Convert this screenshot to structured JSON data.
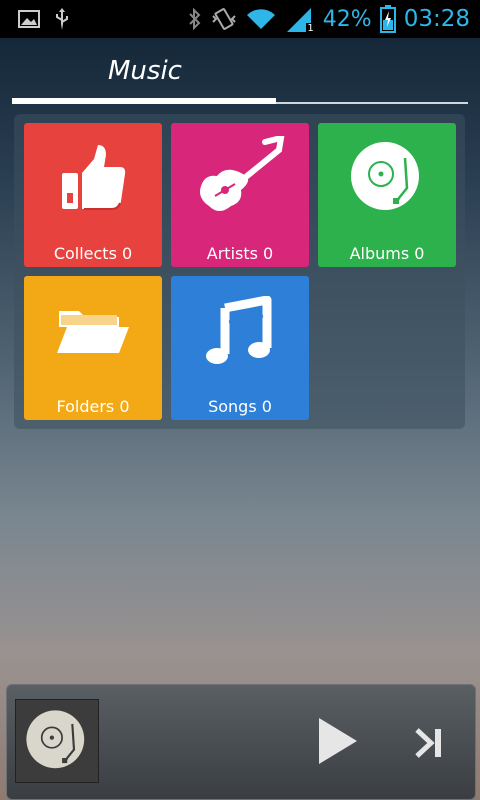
{
  "status_bar": {
    "battery": "42%",
    "time": "03:28",
    "signal_badge": "1",
    "icons": [
      "image-icon",
      "usb-icon",
      "bluetooth-icon",
      "vibrate-icon",
      "wifi-icon",
      "signal-icon",
      "battery-charging-icon"
    ],
    "accent": "#2fb6e8"
  },
  "header": {
    "title": "Music"
  },
  "tiles": [
    {
      "label": "Collects 0",
      "icon": "thumbs-up-icon",
      "color": "#e8423f"
    },
    {
      "label": "Artists 0",
      "icon": "guitar-icon",
      "color": "#d8267b"
    },
    {
      "label": "Albums 0",
      "icon": "vinyl-icon",
      "color": "#2db14d"
    },
    {
      "label": "Folders 0",
      "icon": "folder-icon",
      "color": "#f3a816"
    },
    {
      "label": "Songs 0",
      "icon": "music-note-icon",
      "color": "#2e7fd8"
    }
  ],
  "player": {
    "art_icon": "vinyl-icon",
    "controls": [
      "play-icon",
      "next-icon"
    ]
  }
}
